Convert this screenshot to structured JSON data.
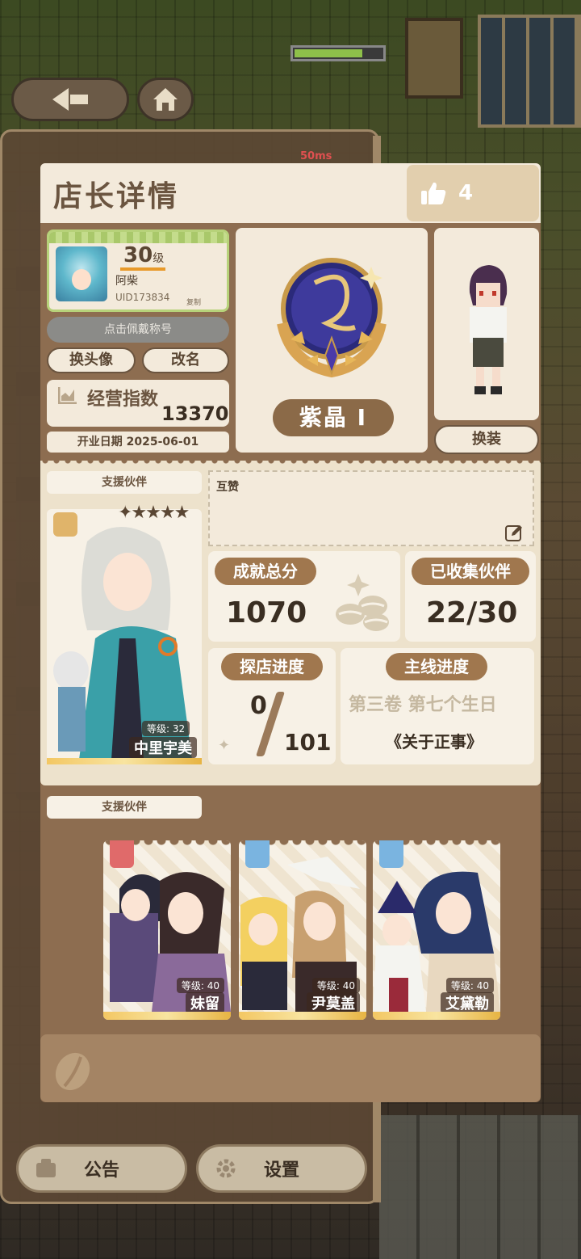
{
  "header": {
    "title": "店长详情",
    "likes": "4"
  },
  "status": {
    "latency": "50ms"
  },
  "profile": {
    "level": "30",
    "level_unit": "级",
    "name": "阿柴",
    "uid": "UID173834",
    "copy_label": "复制",
    "title_button": "点击佩戴称号",
    "change_avatar": "换头像",
    "rename": "改名",
    "ops_label": "经营指数",
    "ops_value": "13370",
    "open_date": "开业日期 2025-06-01"
  },
  "rank": {
    "label": "紫晶 I"
  },
  "dress": {
    "button": "换装"
  },
  "support_main": {
    "tag": "支援伙伴",
    "stars": "✦★★★★",
    "level": "等级: 32",
    "name": "中里宇美"
  },
  "mutual": {
    "label": "互赞"
  },
  "stats": {
    "achievement_label": "成就总分",
    "achievement_value": "1070",
    "collected_label": "已收集伙伴",
    "collected_value": "22/30",
    "explore_label": "探店进度",
    "explore_current": "0",
    "explore_total": "101",
    "story_label": "主线进度",
    "story_chapter": "第三卷 第七个生日",
    "story_title": "《关于正事》"
  },
  "support_list": {
    "tag": "支援伙伴",
    "partners": [
      {
        "name": "妹留",
        "level": "等级: 40",
        "badge_color": "#e06a6a"
      },
      {
        "name": "尹莫盖",
        "level": "等级: 40",
        "badge_color": "#7ab4e0"
      },
      {
        "name": "艾黛勒",
        "level": "等级: 40",
        "badge_color": "#7ab4e0"
      }
    ]
  },
  "bottom_nav": {
    "notice": "公告",
    "settings": "设置"
  }
}
